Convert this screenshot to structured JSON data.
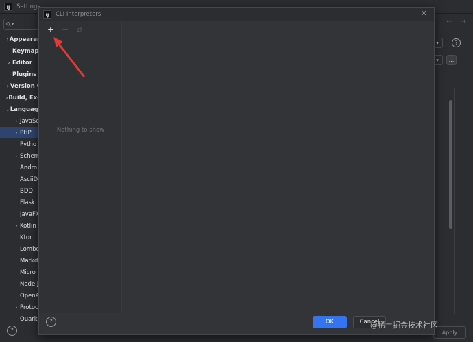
{
  "settings": {
    "title": "Settings",
    "search_placeholder": "",
    "tree": [
      {
        "label": "Appearan",
        "arrow": ">",
        "bold": true,
        "indent": 0
      },
      {
        "label": "Keymap",
        "arrow": "",
        "bold": true,
        "indent": 0
      },
      {
        "label": "Editor",
        "arrow": ">",
        "bold": true,
        "indent": 0
      },
      {
        "label": "Plugins",
        "arrow": "",
        "bold": true,
        "indent": 0
      },
      {
        "label": "Version C",
        "arrow": ">",
        "bold": true,
        "indent": 0
      },
      {
        "label": "Build, Exe",
        "arrow": ">",
        "bold": true,
        "indent": 0
      },
      {
        "label": "Language",
        "arrow": "v",
        "bold": true,
        "indent": 0
      },
      {
        "label": "JavaSc",
        "arrow": ">",
        "bold": false,
        "indent": 1
      },
      {
        "label": "PHP",
        "arrow": ">",
        "bold": false,
        "indent": 1,
        "selected": true
      },
      {
        "label": "Pytho",
        "arrow": "",
        "bold": false,
        "indent": 1
      },
      {
        "label": "Schem",
        "arrow": ">",
        "bold": false,
        "indent": 1
      },
      {
        "label": "Andro",
        "arrow": "",
        "bold": false,
        "indent": 1
      },
      {
        "label": "AsciiD",
        "arrow": "",
        "bold": false,
        "indent": 1
      },
      {
        "label": "BDD",
        "arrow": "",
        "bold": false,
        "indent": 1
      },
      {
        "label": "Flask",
        "arrow": "",
        "bold": false,
        "indent": 1
      },
      {
        "label": "JavaFX",
        "arrow": "",
        "bold": false,
        "indent": 1
      },
      {
        "label": "Kotlin",
        "arrow": ">",
        "bold": false,
        "indent": 1
      },
      {
        "label": "Ktor",
        "arrow": "",
        "bold": false,
        "indent": 1
      },
      {
        "label": "Lombo",
        "arrow": "",
        "bold": false,
        "indent": 1
      },
      {
        "label": "Markd",
        "arrow": "",
        "bold": false,
        "indent": 1
      },
      {
        "label": "Micro",
        "arrow": "",
        "bold": false,
        "indent": 1
      },
      {
        "label": "Node.j",
        "arrow": "",
        "bold": false,
        "indent": 1
      },
      {
        "label": "OpenA",
        "arrow": "",
        "bold": false,
        "indent": 1
      },
      {
        "label": "Protoc",
        "arrow": ">",
        "bold": false,
        "indent": 1
      },
      {
        "label": "Quark",
        "arrow": "",
        "bold": false,
        "indent": 1
      }
    ],
    "help_glyph": "?",
    "apply_label": "Apply",
    "dots_label": "...",
    "nav_back": "←",
    "nav_forward": "→"
  },
  "dialog": {
    "title": "CLI Interpreters",
    "close_glyph": "✕",
    "toolbar": {
      "add": "+",
      "remove": "−",
      "copy": "⧉"
    },
    "empty_text": "Nothing to show",
    "help_glyph": "?",
    "ok_label": "OK",
    "cancel_label": "Cancel"
  },
  "app_icon_text": "IJ",
  "watermark": "@稀土掘金技术社区",
  "colors": {
    "accent": "#3574f0",
    "selection": "#2e436e",
    "annotation_arrow": "#e53935"
  }
}
